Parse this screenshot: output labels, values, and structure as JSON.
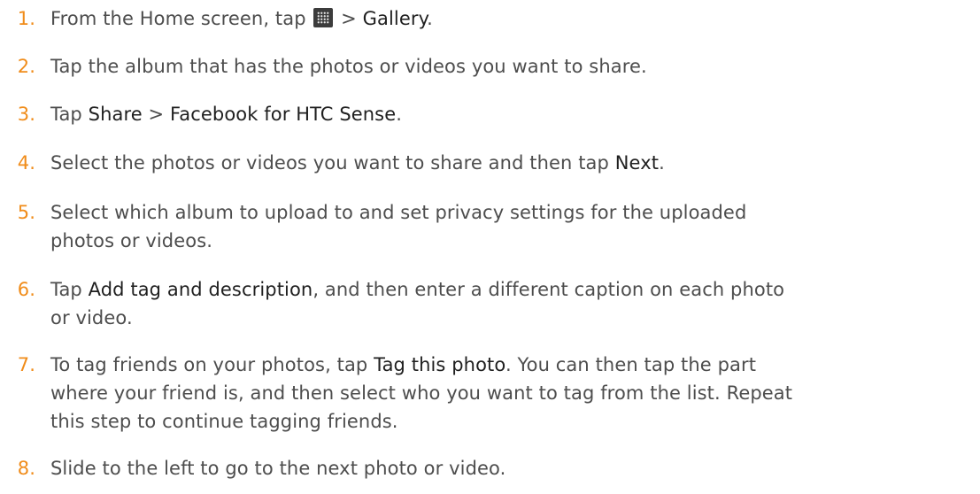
{
  "steps": [
    {
      "number": "1.",
      "lines": [
        {
          "parts": [
            {
              "text": "From the Home screen, tap "
            },
            {
              "icon": "all-apps-icon"
            },
            {
              "text": " > "
            },
            {
              "text": "Gallery",
              "ui": true
            },
            {
              "text": "."
            }
          ]
        }
      ]
    },
    {
      "number": "2.",
      "lines": [
        {
          "parts": [
            {
              "text": "Tap the album that has the photos or videos you want to share."
            }
          ]
        }
      ]
    },
    {
      "number": "3.",
      "lines": [
        {
          "parts": [
            {
              "text": "Tap "
            },
            {
              "text": "Share",
              "ui": true
            },
            {
              "text": " > "
            },
            {
              "text": "Facebook for HTC Sense",
              "ui": true
            },
            {
              "text": "."
            }
          ]
        }
      ]
    },
    {
      "number": "4.",
      "lines": [
        {
          "parts": [
            {
              "text": "Select the photos or videos you want to share and then tap "
            },
            {
              "text": "Next",
              "ui": true
            },
            {
              "text": "."
            }
          ]
        }
      ]
    },
    {
      "number": "5.",
      "lines": [
        {
          "parts": [
            {
              "text": "Select which album to upload to and set privacy settings for the uploaded"
            }
          ]
        },
        {
          "parts": [
            {
              "text": "photos or videos."
            }
          ]
        }
      ]
    },
    {
      "number": "6.",
      "lines": [
        {
          "parts": [
            {
              "text": "Tap "
            },
            {
              "text": "Add tag and description",
              "ui": true
            },
            {
              "text": ", and then enter a different caption on each photo"
            }
          ]
        },
        {
          "parts": [
            {
              "text": "or video."
            }
          ]
        }
      ]
    },
    {
      "number": "7.",
      "lines": [
        {
          "parts": [
            {
              "text": "To tag friends on your photos, tap "
            },
            {
              "text": "Tag this photo",
              "ui": true
            },
            {
              "text": ". You can then tap the part"
            }
          ]
        },
        {
          "parts": [
            {
              "text": "where your friend is, and then select who you want to tag from the list. Repeat"
            }
          ]
        },
        {
          "parts": [
            {
              "text": "this step to continue tagging friends."
            }
          ]
        }
      ]
    },
    {
      "number": "8.",
      "lines": [
        {
          "parts": [
            {
              "text": "Slide to the left to go to the next photo or video."
            }
          ]
        }
      ]
    }
  ]
}
